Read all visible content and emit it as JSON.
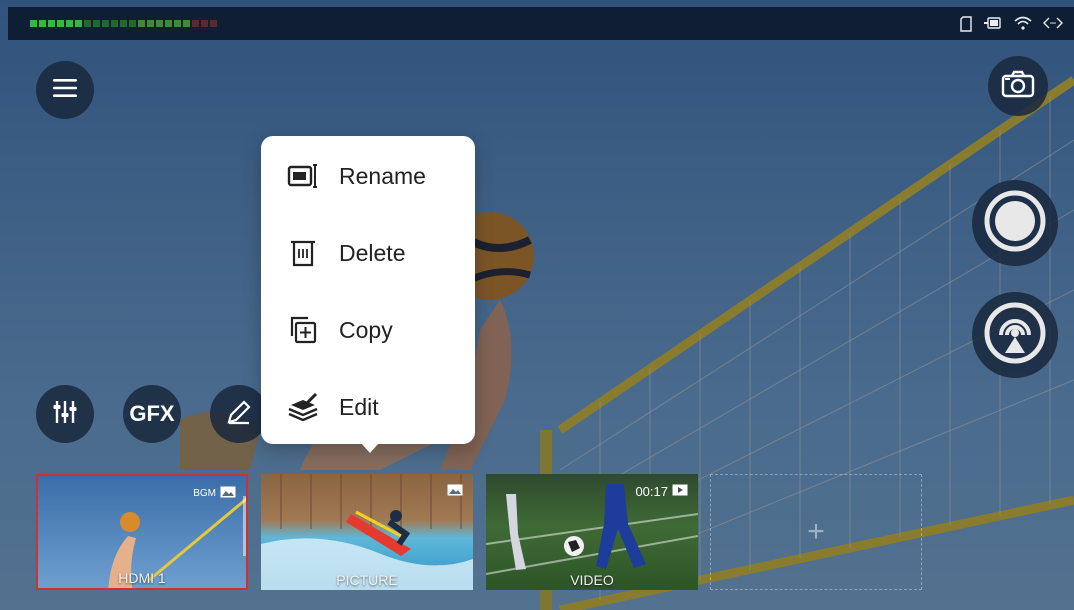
{
  "topbar": {
    "icons": [
      "sd-card-icon",
      "battery-icon",
      "wifi-icon",
      "code-icon"
    ]
  },
  "menu": {
    "items": [
      {
        "label": "Rename",
        "icon": "rename-icon"
      },
      {
        "label": "Delete",
        "icon": "trash-icon"
      },
      {
        "label": "Copy",
        "icon": "copy-icon"
      },
      {
        "label": "Edit",
        "icon": "edit-layers-icon"
      }
    ]
  },
  "toolbar": {
    "gfx_label": "GFX"
  },
  "sources": [
    {
      "label": "HDMI 1",
      "badge": "BGM"
    },
    {
      "label": "PICTURE"
    },
    {
      "label": "VIDEO",
      "duration": "00:17"
    }
  ],
  "add_source_symbol": "+",
  "colors": {
    "accent_selected": "#d03030",
    "meter_green": "#2ea84a",
    "topbar": "#0f1e33"
  }
}
